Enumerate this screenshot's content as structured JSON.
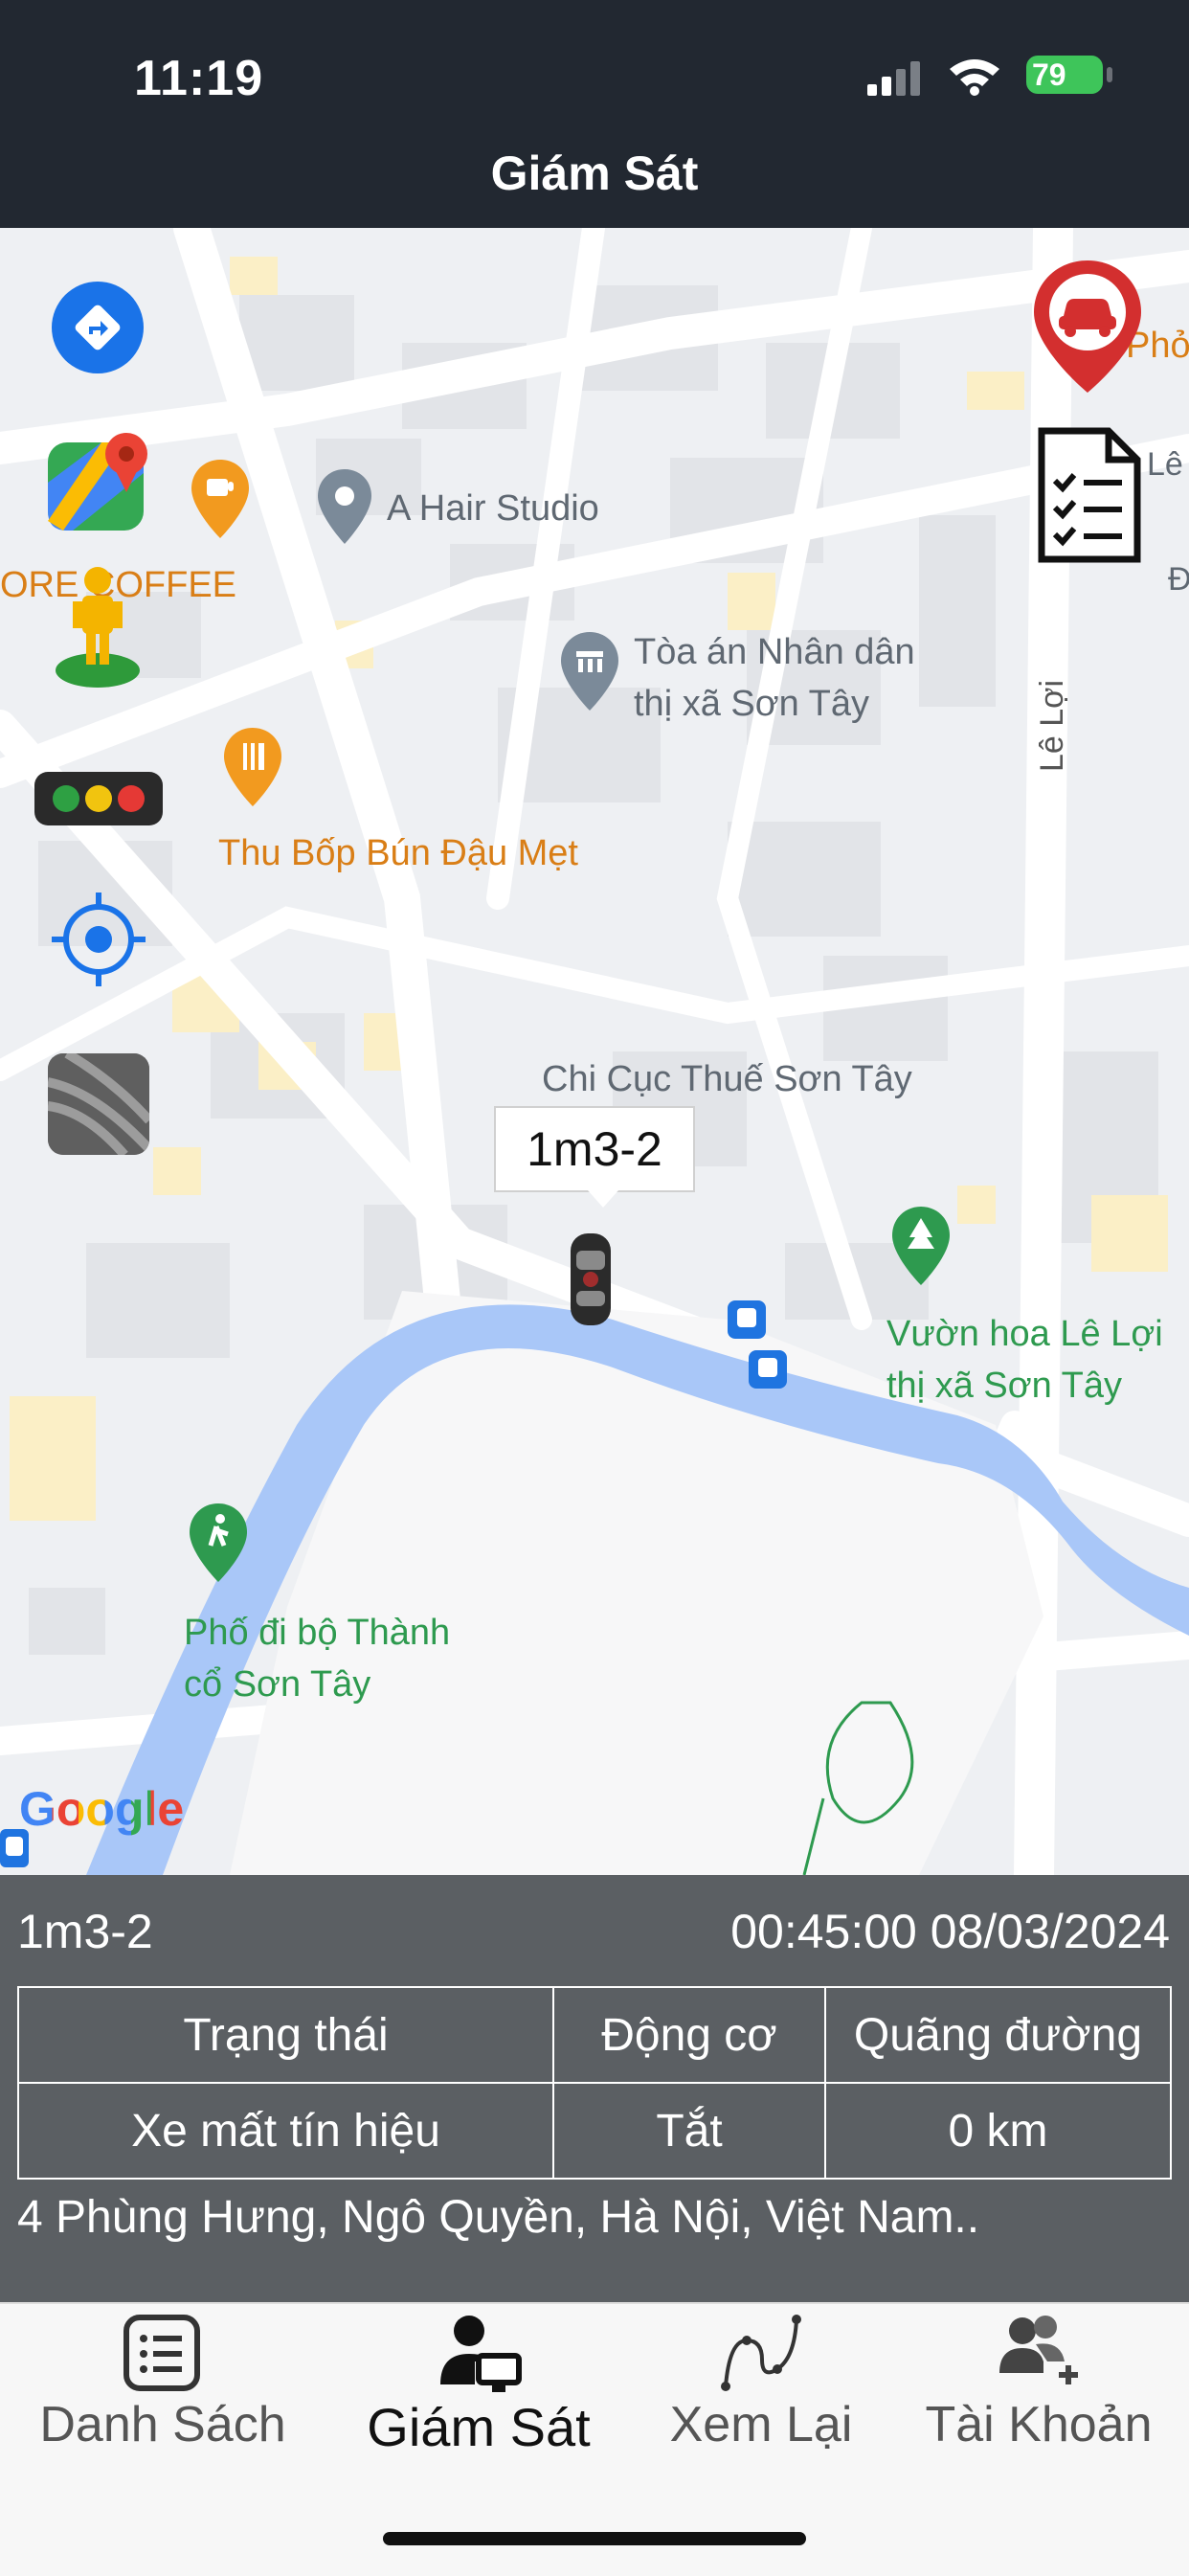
{
  "status_bar": {
    "time": "11:19",
    "battery": "79"
  },
  "header": {
    "title": "Giám Sát"
  },
  "map": {
    "pois": {
      "coffee": "ORE COFFEE",
      "hair": "A Hair Studio",
      "court_line1": "Tòa án Nhân dân",
      "court_line2": "thị xã Sơn Tây",
      "restaurant": "Thu Bốp Bún Đậu Mẹt",
      "tax": "Chi Cục Thuế Sơn Tây",
      "park_line1": "Vườn hoa Lê Lợi",
      "park_line2": "thị xã Sơn Tây",
      "walk_line1": "Phố đi bộ Thành",
      "walk_line2": "cổ Sơn Tây",
      "street": "Lê Lợi",
      "edge_top": "Phở",
      "edge_le": "Lê L",
      "edge_d": "Đ",
      "google": "Google"
    },
    "vehicle_label": "1m3-2"
  },
  "info_panel": {
    "plate": "1m3-2",
    "datetime": "00:45:00 08/03/2024",
    "headers": [
      "Trạng thái",
      "Động cơ",
      "Quãng đường"
    ],
    "values": [
      "Xe mất tín hiệu",
      "Tắt",
      "0 km"
    ],
    "address": "4 Phùng Hưng, Ngô Quyền, Hà Nội, Việt Nam.."
  },
  "tabs": [
    {
      "label": "Danh Sách",
      "icon": "list-icon"
    },
    {
      "label": "Giám Sát",
      "icon": "monitor-user-icon",
      "active": true
    },
    {
      "label": "Xem Lại",
      "icon": "route-icon"
    },
    {
      "label": "Tài Khoản",
      "icon": "add-user-icon"
    }
  ]
}
